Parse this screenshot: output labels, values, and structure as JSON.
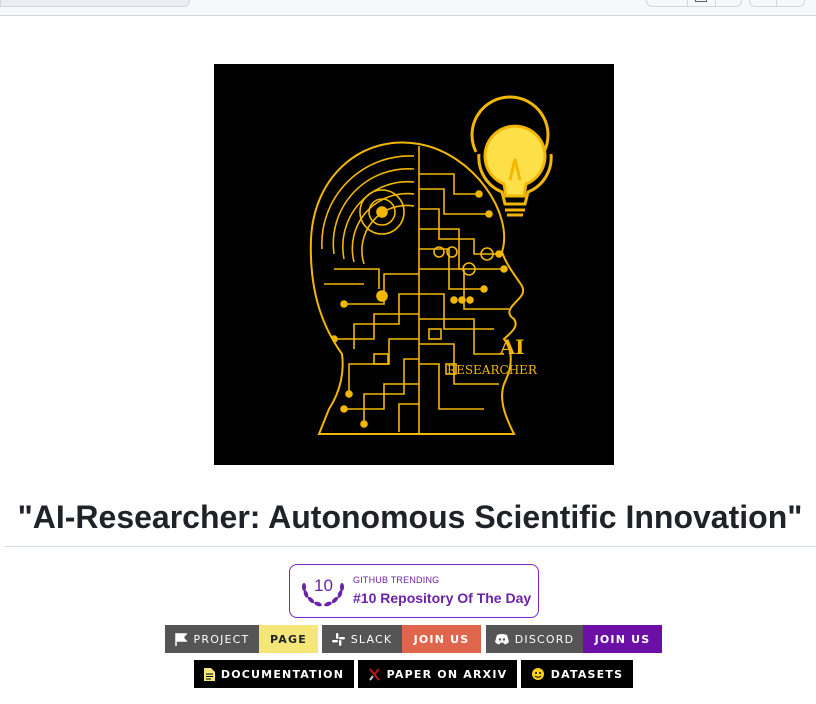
{
  "title": "\"AI-Researcher: Autonomous Scientific Innovation\"",
  "hero": {
    "line1": "AI",
    "line2": "RESEARCHER"
  },
  "trending": {
    "rank": "10",
    "label": "GITHUB TRENDING",
    "text": "#10 Repository Of The Day"
  },
  "badges_row1": [
    {
      "left": "PROJECT",
      "right": "PAGE",
      "icon": "flag-icon",
      "left_color": "#555555",
      "right_color": "#f5e67a",
      "right_text_color": "#1f2328"
    },
    {
      "left": "SLACK",
      "right": "JOIN US",
      "icon": "slack-icon",
      "left_color": "#555555",
      "right_color": "#e0654d",
      "right_text_color": "#ffffff"
    },
    {
      "left": "DISCORD",
      "right": "JOIN US",
      "icon": "discord-icon",
      "left_color": "#555555",
      "right_color": "#6b0fa6",
      "right_text_color": "#ffffff"
    }
  ],
  "badges_row2": [
    {
      "label": "DOCUMENTATION",
      "icon": "document-icon",
      "color": "#000000"
    },
    {
      "label": "PAPER ON ARXIV",
      "icon": "arxiv-icon",
      "color": "#000000"
    },
    {
      "label": "DATASETS",
      "icon": "huggingface-icon",
      "color": "#000000"
    }
  ]
}
